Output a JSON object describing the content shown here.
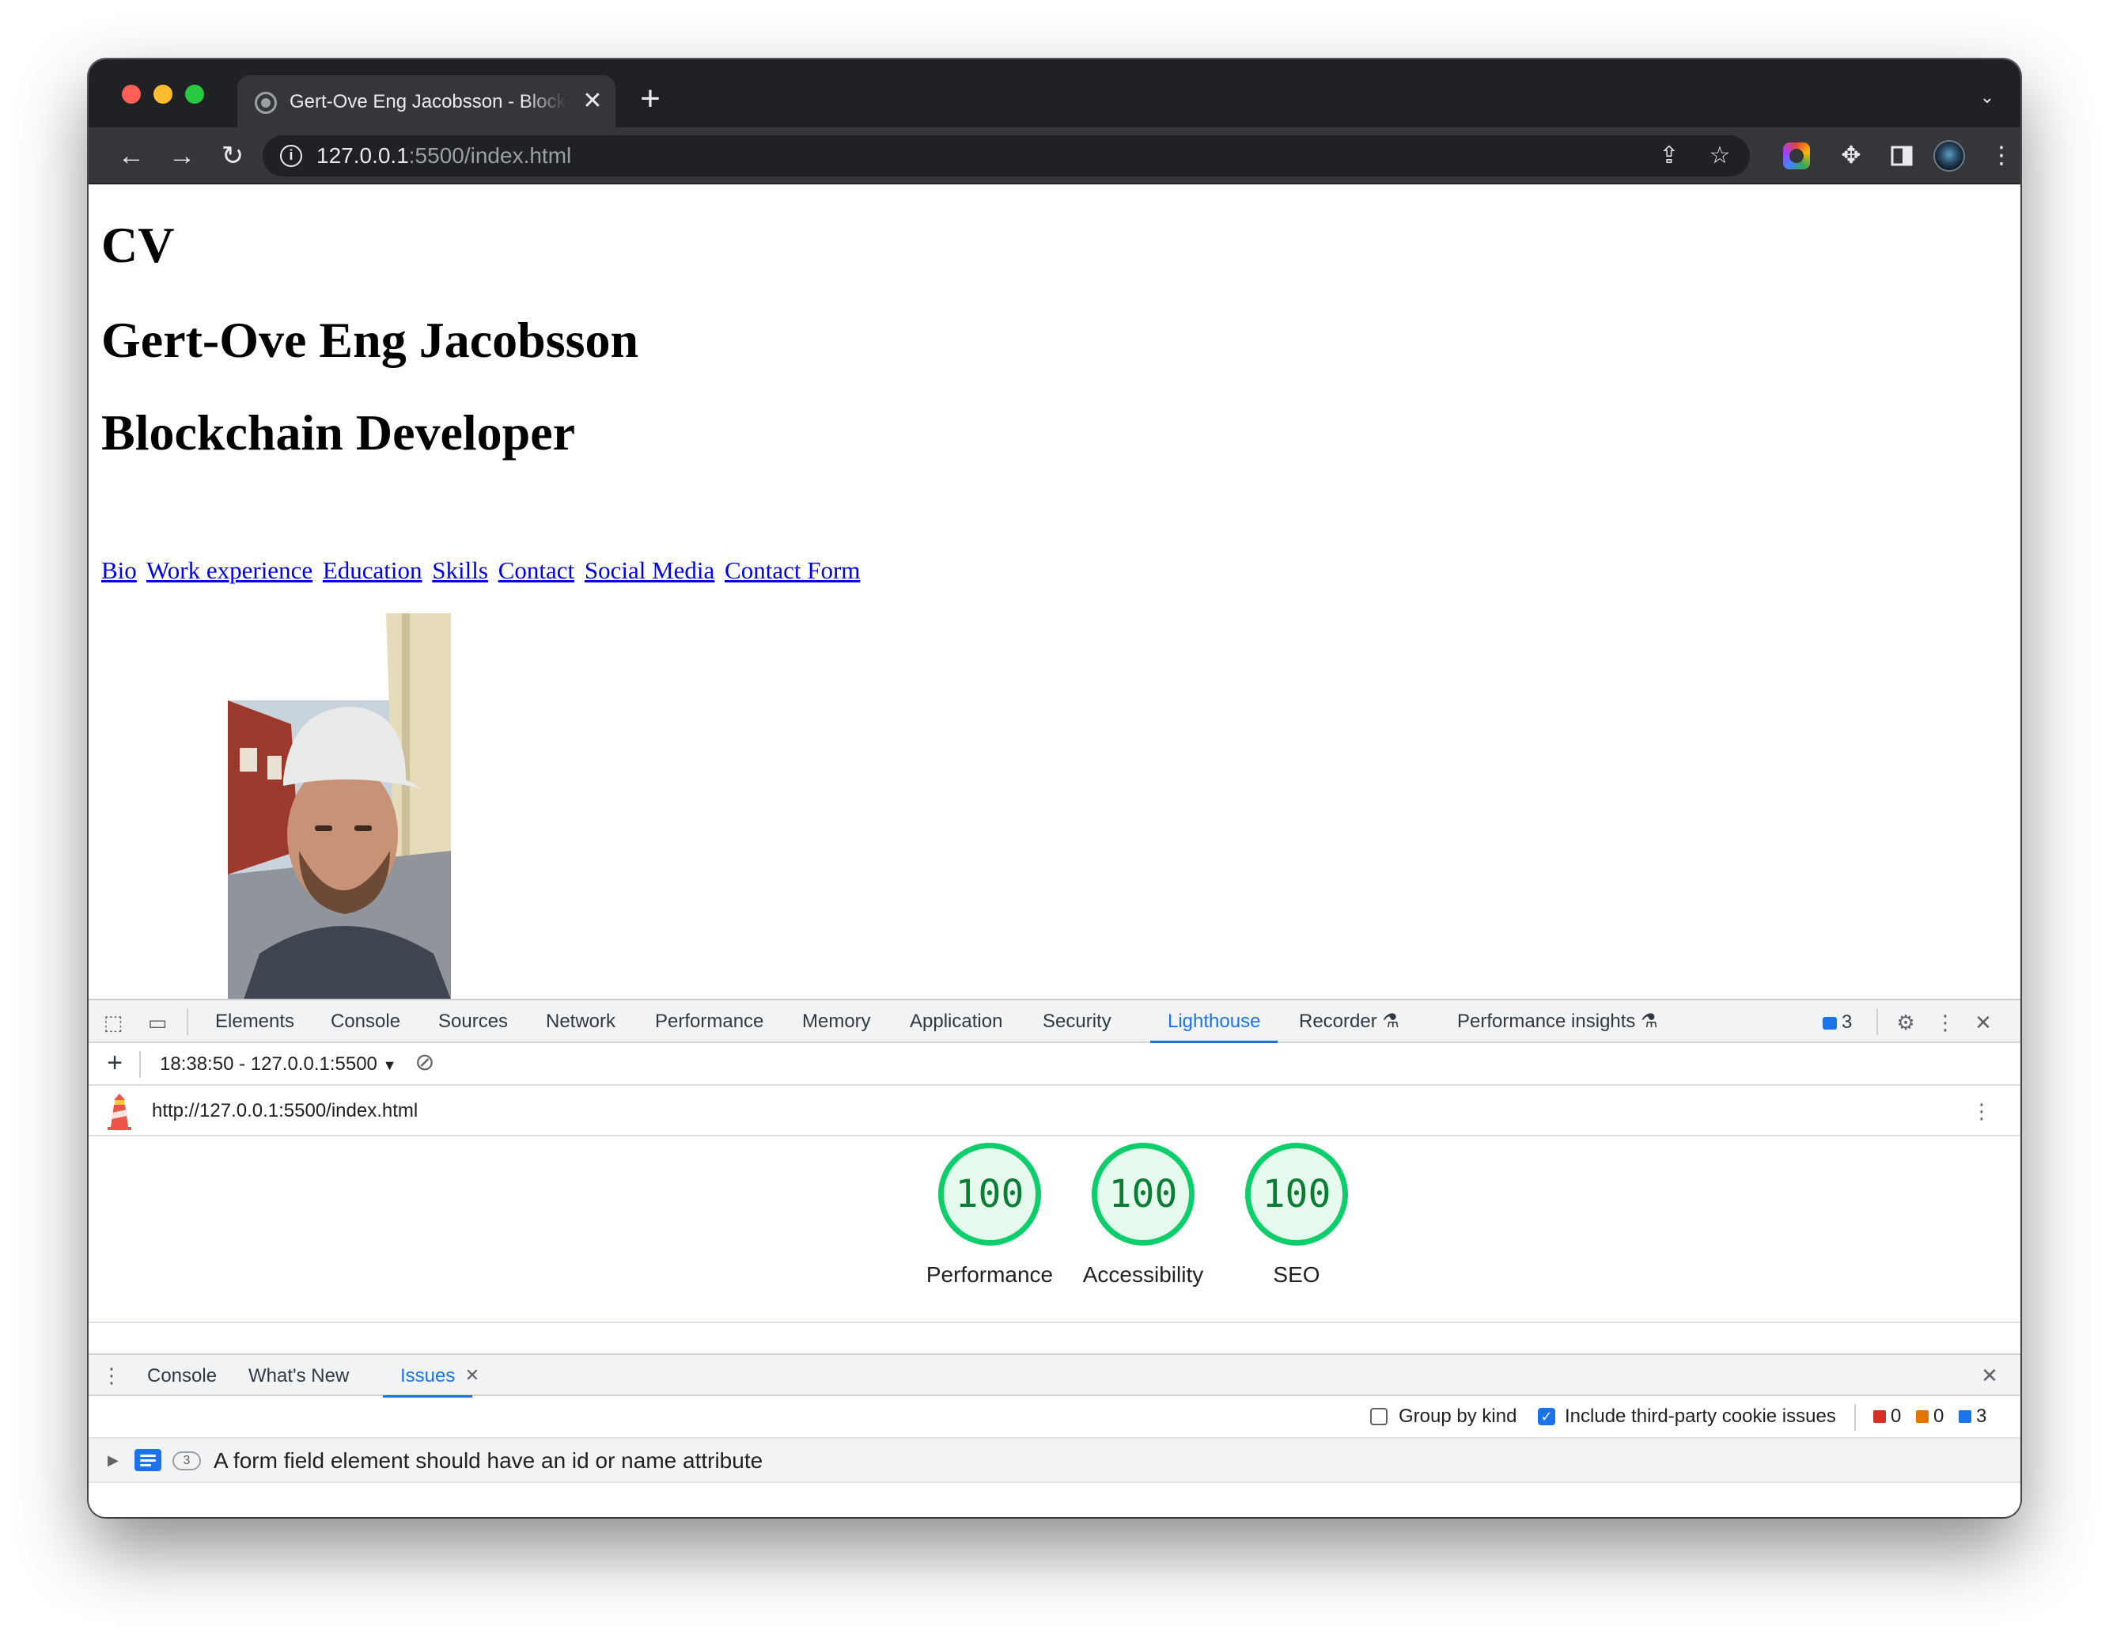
{
  "browser": {
    "tab_title": "Gert-Ove Eng Jacobsson - Blockchain Developer",
    "url_host": "127.0.0.1",
    "url_rest": ":5500/index.html"
  },
  "page": {
    "heading_cv": "CV",
    "heading_name": "Gert-Ove Eng Jacobsson",
    "heading_role": "Blockchain Developer",
    "nav_links": [
      "Bio",
      "Work experience",
      "Education",
      "Skills",
      "Contact",
      "Social Media",
      "Contact Form"
    ]
  },
  "devtools": {
    "tabs": [
      "Elements",
      "Console",
      "Sources",
      "Network",
      "Performance",
      "Memory",
      "Application",
      "Security",
      "Lighthouse",
      "Recorder",
      "Performance insights"
    ],
    "active_tab": "Lighthouse",
    "issues_badge_count": "3",
    "lighthouse": {
      "report_time": "18:38:50 - 127.0.0.1:5500",
      "report_url": "http://127.0.0.1:5500/index.html",
      "scores": [
        {
          "label": "Performance",
          "value": "100"
        },
        {
          "label": "Accessibility",
          "value": "100"
        },
        {
          "label": "SEO",
          "value": "100"
        }
      ],
      "score_color": "#0cce6b"
    },
    "drawer": {
      "tabs": [
        "Console",
        "What's New",
        "Issues"
      ],
      "active_tab": "Issues",
      "group_by_kind": "Group by kind",
      "include_third_party": "Include third-party cookie issues",
      "group_by_kind_checked": false,
      "include_third_party_checked": true,
      "counts": {
        "errors": "0",
        "warnings": "0",
        "info": "3"
      },
      "issue": {
        "count": "3",
        "text": "A form field element should have an id or name attribute"
      }
    }
  }
}
